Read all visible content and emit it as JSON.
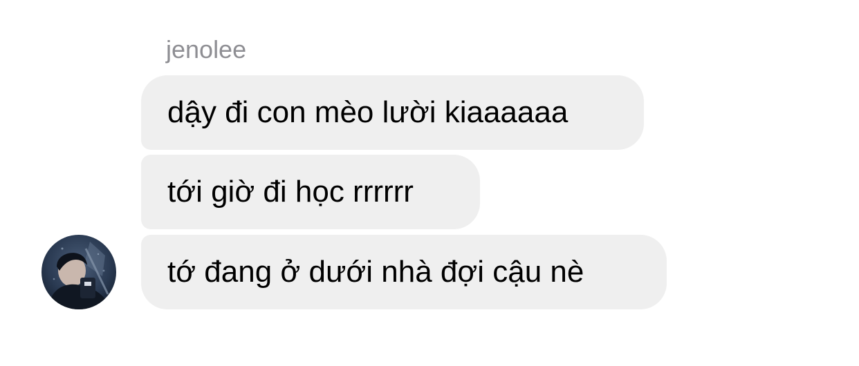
{
  "sender": {
    "name": "jenolee"
  },
  "messages": [
    {
      "text": "dậy đi con mèo lười kiaaaaaa"
    },
    {
      "text": "tới giờ đi học rrrrrr"
    },
    {
      "text": "tớ đang ở dưới nhà đợi cậu nè"
    }
  ],
  "colors": {
    "bubble_bg": "#efefef",
    "sender_name": "#8e8e93",
    "text": "#000000",
    "background": "#ffffff"
  },
  "avatar": {
    "icon": "user-avatar-photo"
  }
}
